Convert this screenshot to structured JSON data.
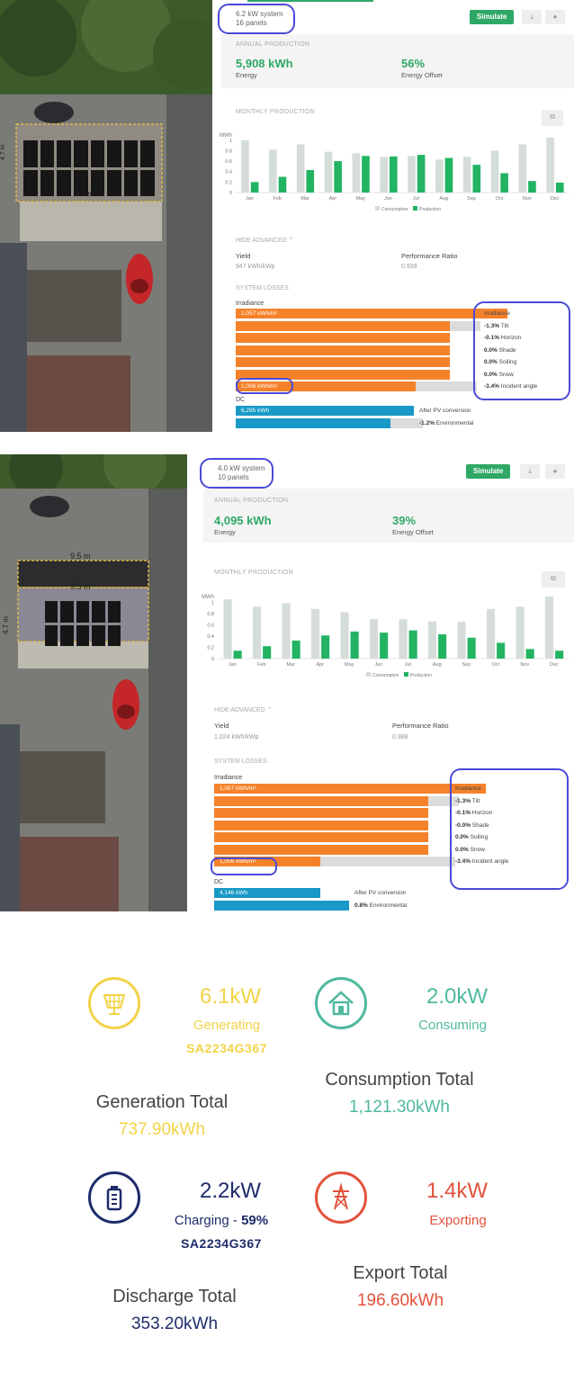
{
  "panels": [
    {
      "system": {
        "size": "6.2 kW system",
        "panels": "16 panels"
      },
      "buttons": {
        "simulate": "Simulate"
      },
      "annual": {
        "caption": "ANNUAL PRODUCTION",
        "energy_value": "5,908 kWh",
        "energy_label": "Energy",
        "offset_value": "56%",
        "offset_label": "Energy Offset"
      },
      "monthly": {
        "caption": "MONTHLY PRODUCTION"
      },
      "advanced": {
        "toggle": "HIDE ADVANCED",
        "yield_label": "Yield",
        "yield_value": "947 kWh/kWp",
        "pr_label": "Performance Ratio",
        "pr_value": "0.939"
      },
      "losses": {
        "caption": "SYSTEM LOSSES",
        "irradiance_label": "Irradiance",
        "irradiance_top": "1,057 kWh/m²",
        "irradiance_bottom": "1,006 kWh/m²",
        "items": [
          {
            "pct": "",
            "name": "Irradiance"
          },
          {
            "pct": "-1.3%",
            "name": "Tilt"
          },
          {
            "pct": "-0.1%",
            "name": "Horizon"
          },
          {
            "pct": "0.0%",
            "name": "Shade"
          },
          {
            "pct": "0.0%",
            "name": "Soiling"
          },
          {
            "pct": "0.0%",
            "name": "Snow"
          },
          {
            "pct": "-3.4%",
            "name": "Incident angle"
          }
        ],
        "dc_label": "DC",
        "dc_value": "6,295 kWh",
        "dc_items": [
          {
            "pct": "",
            "name": "After PV conversion"
          },
          {
            "pct": "-1.2%",
            "name": "Environmental"
          }
        ]
      },
      "aerial_labels": {
        "dim_a": "9.5 m",
        "dim_b": "4.7 m"
      }
    },
    {
      "system": {
        "size": "4.0 kW system",
        "panels": "10 panels"
      },
      "buttons": {
        "simulate": "Simulate"
      },
      "annual": {
        "caption": "ANNUAL PRODUCTION",
        "energy_value": "4,095 kWh",
        "energy_label": "Energy",
        "offset_value": "39%",
        "offset_label": "Energy Offset"
      },
      "monthly": {
        "caption": "MONTHLY PRODUCTION"
      },
      "advanced": {
        "toggle": "HIDE ADVANCED",
        "yield_label": "Yield",
        "yield_value": "1,024 kWh/kWp",
        "pr_label": "Performance Ratio",
        "pr_value": "0.988"
      },
      "losses": {
        "caption": "SYSTEM LOSSES",
        "irradiance_label": "Irradiance",
        "irradiance_top": "1,057 kWh/m²",
        "irradiance_bottom": "1,006 kWh/m²",
        "items": [
          {
            "pct": "",
            "name": "Irradiance"
          },
          {
            "pct": "-1.3%",
            "name": "Tilt"
          },
          {
            "pct": "-0.1%",
            "name": "Horizon"
          },
          {
            "pct": "-0.0%",
            "name": "Shade"
          },
          {
            "pct": "0.0%",
            "name": "Soiling"
          },
          {
            "pct": "0.0%",
            "name": "Snow"
          },
          {
            "pct": "-3.4%",
            "name": "Incident angle"
          }
        ],
        "dc_label": "DC",
        "dc_value": "4,146 kWh",
        "dc_items": [
          {
            "pct": "",
            "name": "After PV conversion"
          },
          {
            "pct": "0.8%",
            "name": "Environmental"
          }
        ]
      },
      "aerial_labels": {
        "dim_a": "9.5 m",
        "dim_b": "4.7 m"
      }
    }
  ],
  "chart_data": [
    {
      "type": "bar",
      "ylabel": "MWh",
      "categories": [
        "Jan",
        "Feb",
        "Mar",
        "Apr",
        "May",
        "Jun",
        "Jul",
        "Aug",
        "Sep",
        "Oct",
        "Nov",
        "Dec"
      ],
      "yticks": [
        "0",
        "0.2",
        "0.4",
        "0.6",
        "0.8",
        "1"
      ],
      "ylim": [
        0,
        1.1
      ],
      "legend_position": "bottom",
      "series": [
        {
          "name": "Consumption",
          "values": [
            1.0,
            0.82,
            0.92,
            0.78,
            0.75,
            0.68,
            0.7,
            0.63,
            0.68,
            0.8,
            0.92,
            1.05
          ]
        },
        {
          "name": "Production",
          "values": [
            0.2,
            0.3,
            0.43,
            0.6,
            0.7,
            0.69,
            0.72,
            0.66,
            0.53,
            0.37,
            0.22,
            0.19
          ]
        }
      ]
    },
    {
      "type": "bar",
      "ylabel": "MWh",
      "categories": [
        "Jan",
        "Feb",
        "Mar",
        "Apr",
        "May",
        "Jun",
        "Jul",
        "Aug",
        "Sep",
        "Oct",
        "Nov",
        "Dec"
      ],
      "yticks": [
        "0",
        "0.2",
        "0.4",
        "0.6",
        "0.8",
        "1"
      ],
      "ylim": [
        0,
        1.1
      ],
      "legend_position": "bottom",
      "series": [
        {
          "name": "Consumption",
          "values": [
            1.05,
            0.92,
            0.98,
            0.88,
            0.82,
            0.7,
            0.7,
            0.66,
            0.65,
            0.88,
            0.92,
            1.1
          ]
        },
        {
          "name": "Production",
          "values": [
            0.14,
            0.22,
            0.32,
            0.41,
            0.48,
            0.46,
            0.5,
            0.43,
            0.37,
            0.28,
            0.17,
            0.14
          ]
        }
      ]
    }
  ],
  "dashboard": {
    "colors": {
      "solar": "#f2d348",
      "home": "#4fb99f",
      "battery": "#1e2c6b",
      "export": "#e2533c"
    },
    "generation": {
      "power": "6.1kW",
      "state": "Generating",
      "serial": "SA2234G367",
      "total_label": "Generation Total",
      "total_value": "737.90kWh",
      "icon": "solar-panel-icon"
    },
    "consumption": {
      "power": "2.0kW",
      "state": "Consuming",
      "total_label": "Consumption Total",
      "total_value": "1,121.30kWh",
      "icon": "house-icon"
    },
    "battery": {
      "power": "2.2kW",
      "state": "Charging - ",
      "soc": "59%",
      "serial": "SA2234G367",
      "total_label": "Discharge Total",
      "total_value": "353.20kWh",
      "icon": "battery-icon"
    },
    "export": {
      "power": "1.4kW",
      "state": "Exporting",
      "total_label": "Export Total",
      "total_value": "196.60kWh",
      "icon": "pylon-icon"
    }
  }
}
